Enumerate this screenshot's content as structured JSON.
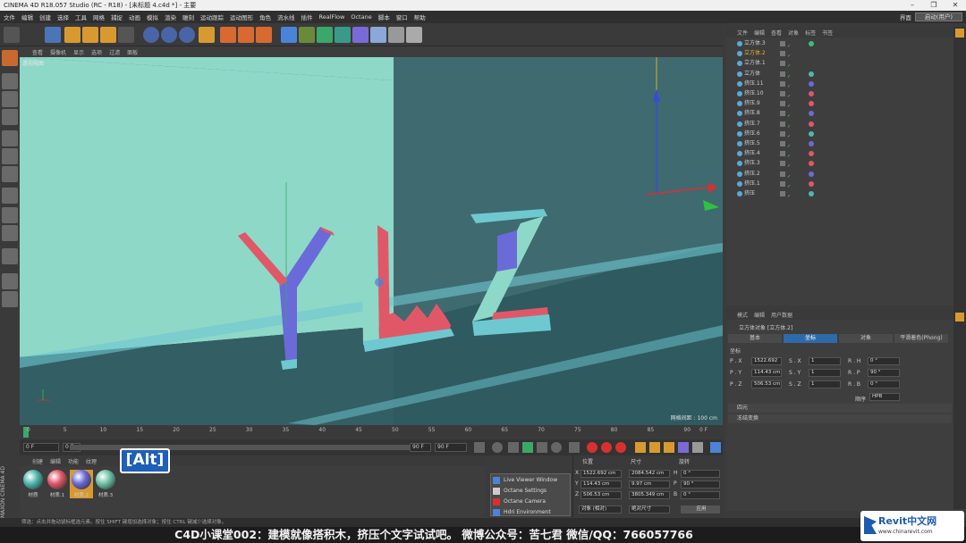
{
  "window": {
    "title": "CINEMA 4D R18.057 Studio (RC - R18) - [未标题 4.c4d *] - 主要"
  },
  "menu": {
    "items": [
      "文件",
      "编辑",
      "创建",
      "选择",
      "工具",
      "网格",
      "捕捉",
      "动画",
      "模拟",
      "渲染",
      "雕刻",
      "运动跟踪",
      "运动图形",
      "角色",
      "流水线",
      "插件",
      "RealFlow",
      "Octane",
      "脚本",
      "窗口",
      "帮助"
    ],
    "layout_label": "界面",
    "layout_value": "启动(用户)"
  },
  "viewport": {
    "menu": [
      "查看",
      "摄像机",
      "显示",
      "选项",
      "过滤",
      "面板"
    ],
    "label": "透视视图",
    "grid_info": "网格间距 : 100 cm"
  },
  "timeline": {
    "ticks": [
      "0",
      "5",
      "10",
      "15",
      "20",
      "25",
      "30",
      "35",
      "40",
      "45",
      "50",
      "55",
      "60",
      "65",
      "70",
      "75",
      "80",
      "85",
      "90"
    ],
    "end_label": "0 F",
    "start_field": "0 F",
    "range_start": "0 F",
    "range_end": "90 F",
    "max_field": "90 F"
  },
  "materials": {
    "menu": [
      "创建",
      "编辑",
      "功能",
      "纹理"
    ],
    "items": [
      {
        "name": "材质",
        "color": "#4fb7ad"
      },
      {
        "name": "材质.1",
        "color": "#e05868"
      },
      {
        "name": "材质.2",
        "color": "#6a6ad8"
      },
      {
        "name": "材质.3",
        "color": "#6fc3a7"
      }
    ],
    "overlay_key": "[Alt]"
  },
  "octane_menu": [
    "Live Viewer Window",
    "Octane Settings",
    "Octane Camera",
    "Hdri Environment"
  ],
  "coords": {
    "headers": [
      "位置",
      "尺寸",
      "旋转"
    ],
    "rows": [
      {
        "axis": "X",
        "pos": "1522.692 cm",
        "size": "2084.542 cm",
        "rot_label": "H",
        "rot": "0 °"
      },
      {
        "axis": "Y",
        "pos": "114.43 cm",
        "size": "9.97 cm",
        "rot_label": "P",
        "rot": "90 °"
      },
      {
        "axis": "Z",
        "pos": "506.53 cm",
        "size": "3805.349 cm",
        "rot_label": "B",
        "rot": "0 °"
      }
    ],
    "mode_object": "对象 (相对)",
    "mode_size": "绝对尺寸",
    "apply": "应用"
  },
  "object_manager": {
    "menu": [
      "文件",
      "编辑",
      "查看",
      "对象",
      "标签",
      "书签"
    ],
    "objects": [
      {
        "name": "立方体.3",
        "tag": "#3dbd7d",
        "highlight": false
      },
      {
        "name": "立方体.2",
        "tag": "",
        "highlight": true
      },
      {
        "name": "立方体.1",
        "tag": "",
        "highlight": false
      },
      {
        "name": "立方体",
        "tag": "#4fb7ad",
        "highlight": false
      },
      {
        "name": "挤压.11",
        "tag": "#6a6ad8",
        "highlight": false
      },
      {
        "name": "挤压.10",
        "tag": "#e05868",
        "highlight": false
      },
      {
        "name": "挤压.9",
        "tag": "#e05868",
        "highlight": false
      },
      {
        "name": "挤压.8",
        "tag": "#6a6ad8",
        "highlight": false
      },
      {
        "name": "挤压.7",
        "tag": "#e05868",
        "highlight": false
      },
      {
        "name": "挤压.6",
        "tag": "#4fb7ad",
        "highlight": false
      },
      {
        "name": "挤压.5",
        "tag": "#6a6ad8",
        "highlight": false
      },
      {
        "name": "挤压.4",
        "tag": "#e05868",
        "highlight": false
      },
      {
        "name": "挤压.3",
        "tag": "#e05868",
        "highlight": false
      },
      {
        "name": "挤压.2",
        "tag": "#6a6ad8",
        "highlight": false
      },
      {
        "name": "挤压.1",
        "tag": "#e05868",
        "highlight": false
      },
      {
        "name": "挤压",
        "tag": "#4fb7ad",
        "highlight": false
      }
    ]
  },
  "attributes": {
    "menu": [
      "模式",
      "编辑",
      "用户数据"
    ],
    "object_title": "立方体对象 [立方体.2]",
    "tabs": [
      "基本",
      "坐标",
      "对象",
      "平滑着色(Phong)"
    ],
    "active_tab": "坐标",
    "section": "坐标",
    "rows": [
      {
        "p": "P . X",
        "pv": "1522.692",
        "s": "S . X",
        "sv": "1",
        "r": "R . H",
        "rv": "0 °"
      },
      {
        "p": "P . Y",
        "pv": "114.43 cm",
        "s": "S . Y",
        "sv": "1",
        "r": "R . P",
        "rv": "90 °"
      },
      {
        "p": "P . Z",
        "pv": "506.53 cm",
        "s": "S . Z",
        "sv": "1",
        "r": "R . B",
        "rv": "0 °"
      }
    ],
    "order_label": "顺序",
    "order_value": "HPB",
    "collapsed": [
      "四元",
      "冻结变换"
    ]
  },
  "status": " 筛选：点击并拖动鼠标框选元素。按住 SHIFT 键增加选择对象；按住 CTRL 键减少选择对象。",
  "subtitle": "C4D小课堂002：建模就像搭积木，挤压个文字试试吧。   微博公众号：苦七君   微信/QQ：766057766",
  "watermark": {
    "brand": "Revit中文网",
    "url": "www.chinarevit.com"
  },
  "side_brand": "MAXON CINEMA 4D"
}
